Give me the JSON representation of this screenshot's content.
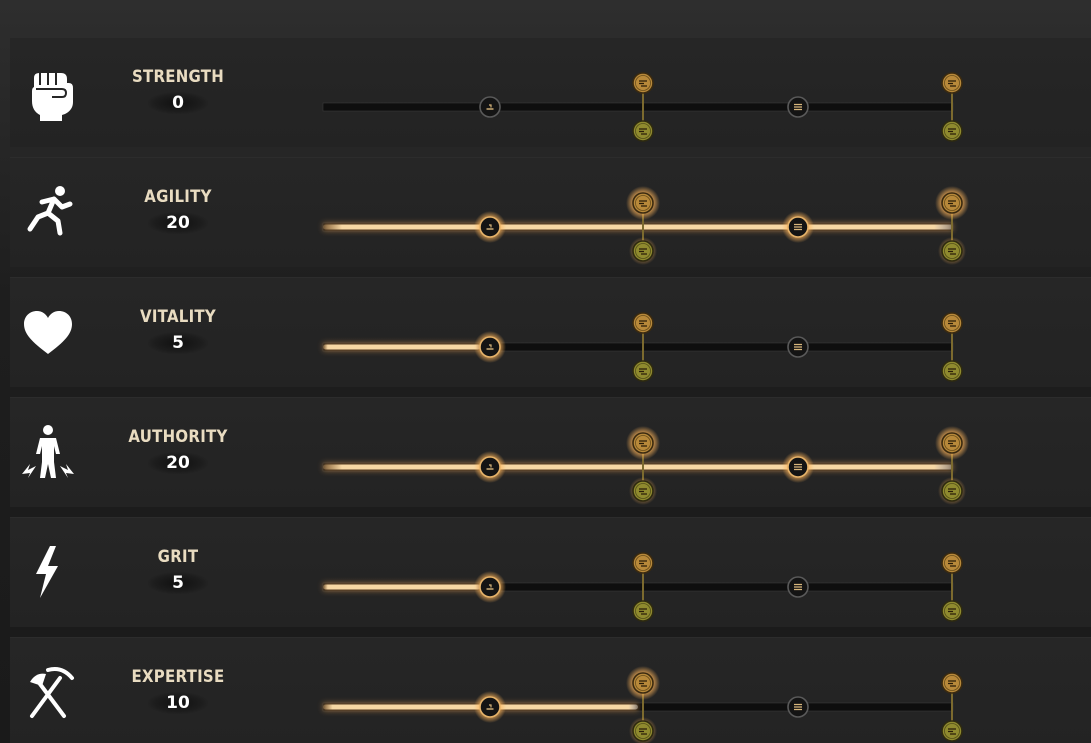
{
  "attributes": [
    {
      "name": "STRENGTH",
      "value": "0",
      "icon": "fist-icon",
      "progress": 0.0
    },
    {
      "name": "AGILITY",
      "value": "20",
      "icon": "runner-icon",
      "progress": 1.0
    },
    {
      "name": "VITALITY",
      "value": "5",
      "icon": "heart-icon",
      "progress": 0.25
    },
    {
      "name": "AUTHORITY",
      "value": "20",
      "icon": "commander-icon",
      "progress": 1.0
    },
    {
      "name": "GRIT",
      "value": "5",
      "icon": "lightning-icon",
      "progress": 0.25
    },
    {
      "name": "EXPERTISE",
      "value": "10",
      "icon": "pickaxe-axe-icon",
      "progress": 0.5
    }
  ],
  "thresholds": [
    5,
    10,
    15,
    20
  ],
  "colors": {
    "progress_glow": "#f2c98e",
    "track_dark": "#0e0e0e",
    "node_gold": "#b8893a",
    "node_olive": "#8f8a2e",
    "text_name": "#e9dcc1"
  }
}
